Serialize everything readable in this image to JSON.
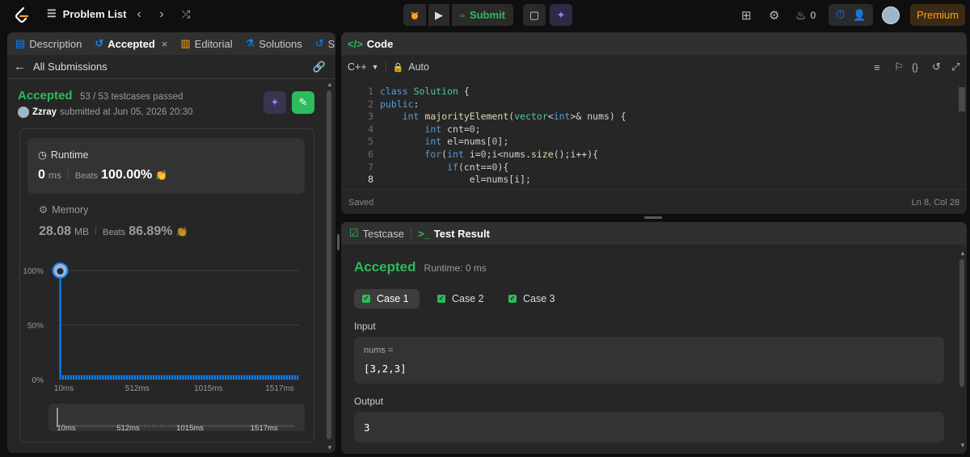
{
  "topbar": {
    "problem_list": "Problem List",
    "submit": "Submit",
    "streak_count": "0",
    "premium": "Premium"
  },
  "left": {
    "tabs": [
      {
        "label": "Description",
        "icon": "document-icon"
      },
      {
        "label": "Accepted",
        "icon": "history-icon"
      },
      {
        "label": "Editorial",
        "icon": "book-icon"
      },
      {
        "label": "Solutions",
        "icon": "flask-icon"
      },
      {
        "label": "Su",
        "icon": "history-icon"
      }
    ],
    "all_submissions": "All Submissions",
    "status": "Accepted",
    "testcases": "53 / 53 testcases passed",
    "user": "Zzray",
    "submitted_at": "submitted at Jun 05, 2026 20:30",
    "runtime": {
      "label": "Runtime",
      "value": "0",
      "unit": "ms",
      "beats_label": "Beats",
      "beats": "100.00%"
    },
    "memory": {
      "label": "Memory",
      "value": "28.08",
      "unit": "MB",
      "beats_label": "Beats",
      "beats": "86.89%"
    }
  },
  "chart_data": {
    "type": "bar",
    "x_ticks": [
      "10ms",
      "512ms",
      "1015ms",
      "1517ms"
    ],
    "y_ticks": [
      "100%",
      "50%",
      "0%"
    ],
    "ylim": [
      0,
      100
    ],
    "values": [
      100,
      4,
      4,
      4,
      4,
      4,
      4,
      4,
      4,
      4,
      4,
      4,
      4,
      4,
      4,
      4,
      4,
      4,
      4,
      4,
      4,
      4,
      4,
      4,
      4,
      4,
      4,
      4,
      4,
      4,
      4,
      4,
      4,
      4,
      4,
      4,
      4,
      4,
      4,
      4,
      4,
      4,
      4,
      4,
      4,
      4,
      4,
      4,
      4,
      4,
      4,
      4,
      4,
      4,
      4,
      4,
      4,
      4,
      4,
      4,
      4,
      4,
      4,
      4,
      4,
      4,
      4,
      4,
      4,
      4,
      4,
      4,
      4,
      4,
      4,
      4,
      4,
      4,
      4,
      4,
      4,
      4,
      4,
      4,
      4,
      4,
      4,
      4,
      4,
      4
    ],
    "grid": true,
    "marker_index": 0,
    "minimap_ticks": [
      "10ms",
      "512ms",
      "1015ms",
      "1517ms"
    ]
  },
  "code": {
    "title": "Code",
    "language": "C++",
    "mode": "Auto",
    "saved": "Saved",
    "cursor": "Ln 8, Col 28",
    "lines": [
      "class Solution {",
      "public:",
      "    int majorityElement(vector<int>& nums) {",
      "        int cnt=0;",
      "        int el=nums[0];",
      "        for(int i=0;i<nums.size();i++){",
      "            if(cnt==0){",
      "                el=nums[i];"
    ]
  },
  "result": {
    "tab_testcase": "Testcase",
    "tab_result": "Test Result",
    "status": "Accepted",
    "runtime": "Runtime: 0 ms",
    "cases": [
      "Case 1",
      "Case 2",
      "Case 3"
    ],
    "input_label": "Input",
    "input_var": "nums =",
    "input_value": "[3,2,3]",
    "output_label": "Output",
    "output_value": "3"
  },
  "colors": {
    "accent_green": "#2cbb5d",
    "premium": "#ffa116",
    "link_blue": "#0a84ff",
    "purple": "#7f5af0"
  }
}
